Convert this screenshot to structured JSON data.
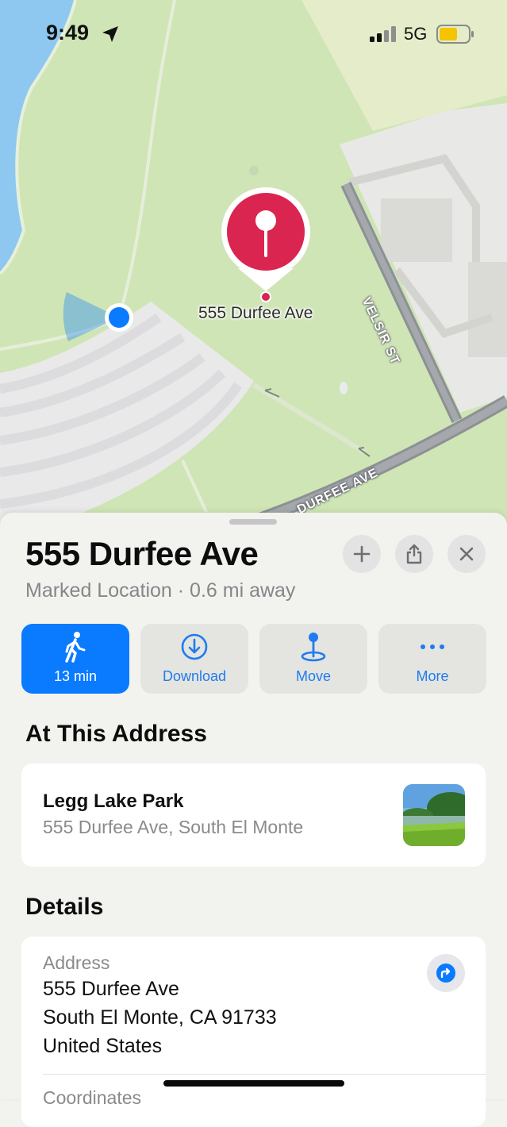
{
  "status_bar": {
    "time": "9:49",
    "network": "5G",
    "location_icon": "location-arrow-icon",
    "battery_color": "#f5c400"
  },
  "map": {
    "pin_label": "555 Durfee Ave",
    "streets": [
      "VELSIR ST",
      "DURFEE AVE"
    ],
    "pin_color": "#d9254f",
    "user_dot_color": "#0a7bff",
    "park_color": "#cfe5b6",
    "water_color": "#8ec8f0"
  },
  "sheet": {
    "title": "555 Durfee Ave",
    "subtitle": "Marked Location · 0.6 mi away",
    "header_buttons": [
      {
        "icon": "plus-icon"
      },
      {
        "icon": "share-icon"
      },
      {
        "icon": "close-icon"
      }
    ],
    "actions": [
      {
        "label": "13 min",
        "icon": "walking-icon"
      },
      {
        "label": "Download",
        "icon": "download-icon"
      },
      {
        "label": "Move",
        "icon": "move-pin-icon"
      },
      {
        "label": "More",
        "icon": "more-icon"
      }
    ],
    "at_address": {
      "title": "At This Address",
      "place_name": "Legg Lake Park",
      "place_address": "555 Durfee Ave, South El Monte"
    },
    "details": {
      "title": "Details",
      "address_label": "Address",
      "address_lines": [
        "555 Durfee Ave",
        "South El Monte, CA  91733",
        "United States"
      ],
      "next_label": "Coordinates"
    }
  }
}
